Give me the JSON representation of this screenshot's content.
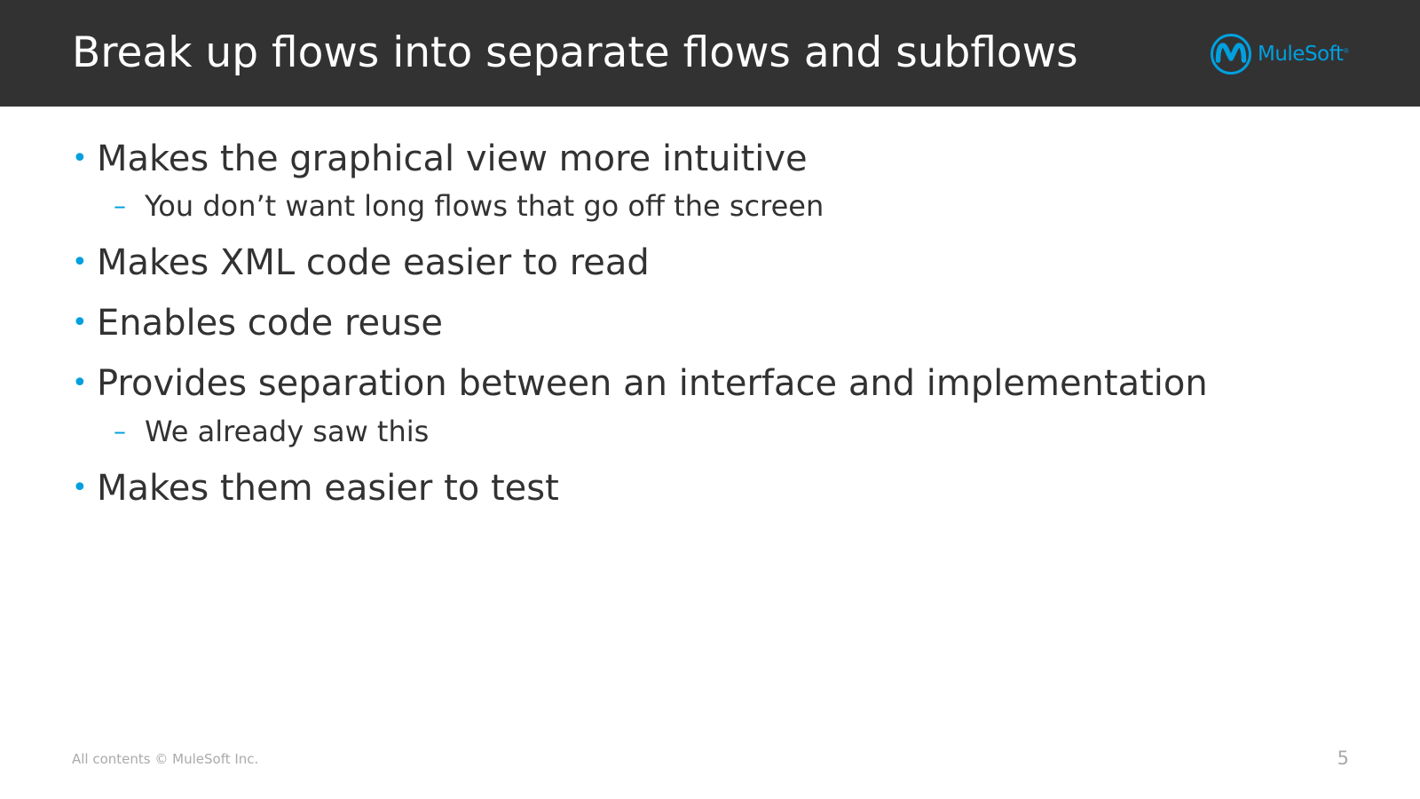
{
  "header": {
    "title": "Break up flows into separate flows and subflows",
    "logo_text": "MuleSoft",
    "logo_mark": "®"
  },
  "body": {
    "bullets": [
      {
        "level": 1,
        "text": "Makes the graphical view more intuitive"
      },
      {
        "level": 2,
        "text": "You don’t want long flows that go off the screen"
      },
      {
        "level": 1,
        "text": "Makes XML code easier to read"
      },
      {
        "level": 1,
        "text": "Enables code reuse"
      },
      {
        "level": 1,
        "text": "Provides separation between an interface and implementation"
      },
      {
        "level": 2,
        "text": "We already saw this"
      },
      {
        "level": 1,
        "text": "Makes them easier to test"
      }
    ],
    "bullet_marker": "•",
    "sub_marker": "–"
  },
  "footer": {
    "copyright": "All contents © MuleSoft Inc.",
    "page_number": "5"
  },
  "colors": {
    "header_bg": "#333233",
    "accent": "#00a0df",
    "text": "#333233",
    "footer_text": "#aaaaaa"
  }
}
